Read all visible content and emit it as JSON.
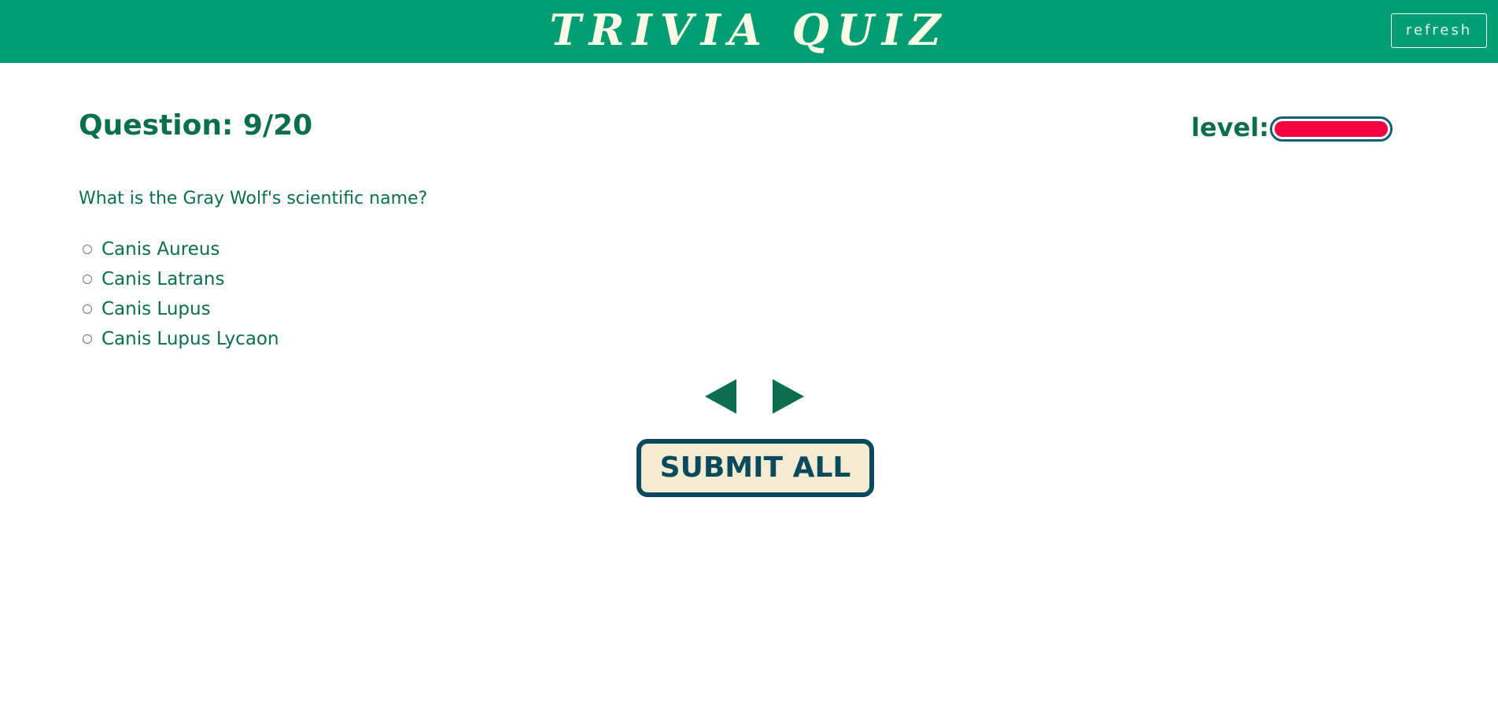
{
  "header": {
    "title": "TRIVIA QUIZ",
    "refresh_label": "refresh",
    "background_color": "#029e73"
  },
  "quiz": {
    "counter_label": "Question: 9/20",
    "level_label": "level:",
    "level_fraction": 1.0,
    "level_color": "#f5053f",
    "question_text": "What is the Gray Wolf's scientific name?",
    "options": [
      {
        "label": "Canis Aureus",
        "selected": false
      },
      {
        "label": "Canis Latrans",
        "selected": false
      },
      {
        "label": "Canis Lupus",
        "selected": false
      },
      {
        "label": "Canis Lupus Lycaon",
        "selected": false
      }
    ]
  },
  "navigation": {
    "prev_icon": "triangle-left-icon",
    "next_icon": "triangle-right-icon",
    "arrow_color": "#0b6e4f"
  },
  "submit": {
    "label": "SUBMIT ALL"
  }
}
